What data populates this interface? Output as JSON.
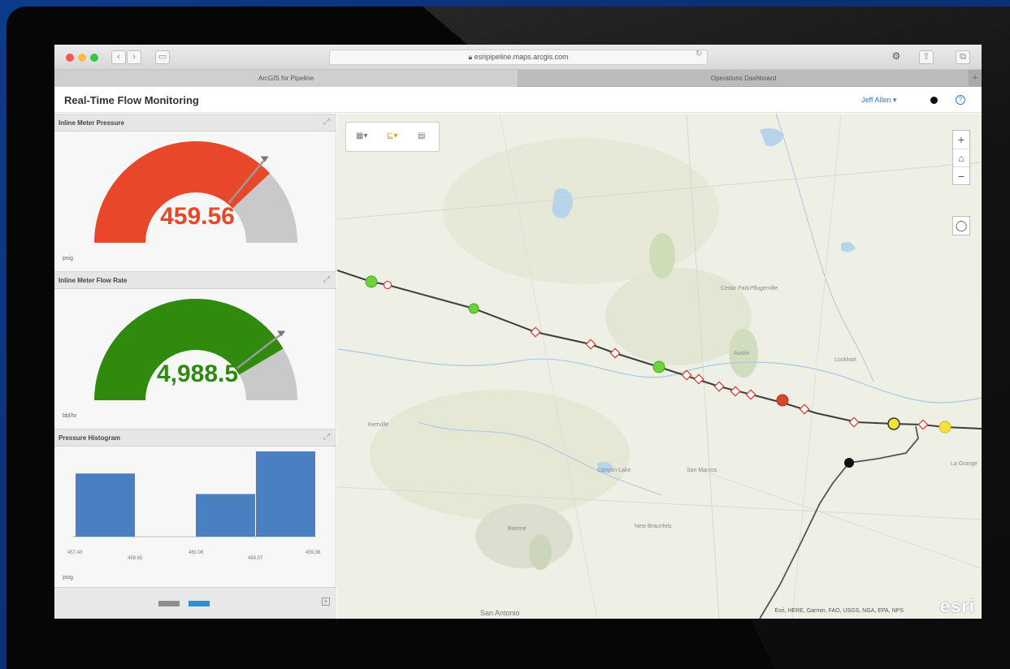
{
  "browser": {
    "url": "esripipeline.maps.arcgis.com",
    "tabs": [
      {
        "label": "ArcGIS for Pipeline",
        "active": true
      },
      {
        "label": "Operations Dashboard",
        "active": false
      }
    ],
    "traffic_colors": [
      "#fc5753",
      "#fdbc40",
      "#33c748"
    ]
  },
  "app": {
    "title": "Real-Time Flow Monitoring",
    "user": "Jeff Allen ▾"
  },
  "widgets": {
    "pressure": {
      "title": "Inline Meter Pressure",
      "value": "459.56",
      "unit": "psig",
      "fraction": 0.76,
      "color": "#e8472a"
    },
    "flow": {
      "title": "Inline Meter Flow Rate",
      "value": "4,988.5",
      "unit": "bbl/hr",
      "fraction": 0.83,
      "color": "#2f8a0e"
    },
    "histogram": {
      "title": "Pressure Histogram",
      "unit": "psig",
      "ticks": [
        "457.43",
        "458.65",
        "460.06",
        "459.07",
        "459.36"
      ],
      "bars": [
        {
          "value": 4
        },
        {
          "value": 0
        },
        {
          "value": 2.7
        },
        {
          "value": 5.4
        }
      ]
    }
  },
  "map": {
    "attribution": "Esri, HERE, Garmin, FAO, USGS, NGA, EPA, NPS",
    "logo": "esri",
    "labels": [
      {
        "text": "Cedar Park",
        "cls": "maplabel"
      },
      {
        "text": "Pflugerville",
        "cls": "maplabel"
      },
      {
        "text": "Austin",
        "cls": "maplabel"
      },
      {
        "text": "San Marcos",
        "cls": "maplabel"
      },
      {
        "text": "New Braunfels",
        "cls": "maplabel"
      },
      {
        "text": "San Antonio",
        "cls": "city-big"
      },
      {
        "text": "Lockhart",
        "cls": "maplabel"
      },
      {
        "text": "Canyon Lake",
        "cls": "maplabel"
      },
      {
        "text": "Kerrville",
        "cls": "maplabel"
      },
      {
        "text": "Boerne",
        "cls": "maplabel"
      },
      {
        "text": "La Grange",
        "cls": "maplabel"
      }
    ]
  }
}
